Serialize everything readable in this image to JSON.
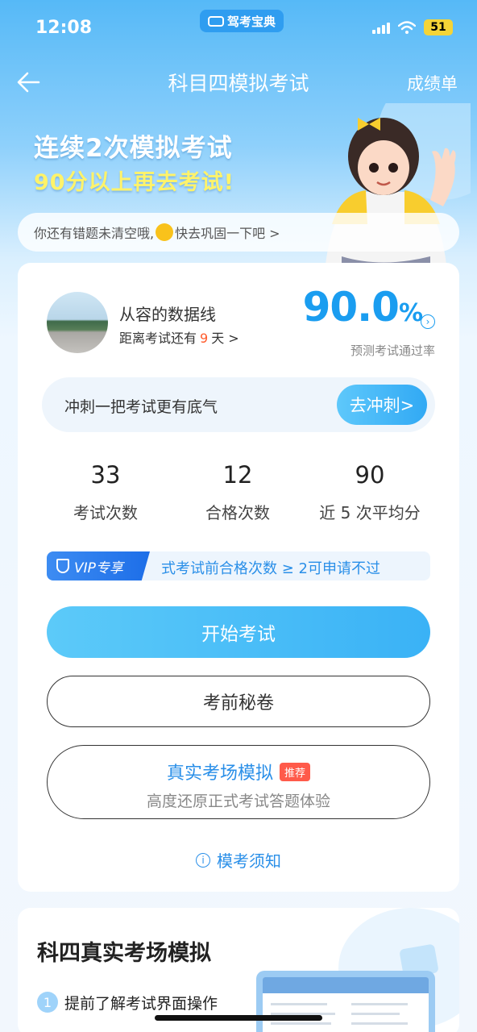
{
  "status_bar": {
    "time": "12:08",
    "app_name": "驾考宝典",
    "battery": "51"
  },
  "nav": {
    "title": "科目四模拟考试",
    "right_link": "成绩单",
    "back_icon": "arrow-left-icon"
  },
  "banner": {
    "line1": "连续2次模拟考试",
    "line2": "90分以上再去考试!"
  },
  "tip": {
    "text_before": "你还有错题未清空哦,",
    "text_after": "快去巩固一下吧 >"
  },
  "profile": {
    "name": "从容的数据线",
    "countdown_prefix": "距离考试还有",
    "countdown_days": "9",
    "countdown_suffix": "天  >"
  },
  "pass_rate": {
    "value": "90.0",
    "unit": "%",
    "label": "预测考试通过率"
  },
  "sprint": {
    "text": "冲刺一把考试更有底气",
    "button": "去冲刺>"
  },
  "stats": [
    {
      "value": "33",
      "label": "考试次数"
    },
    {
      "value": "12",
      "label": "合格次数"
    },
    {
      "value": "90",
      "label": "近 5 次平均分"
    }
  ],
  "vip": {
    "badge": "VIP专享",
    "text": "式考试前合格次数 ≥ 2可申请不过"
  },
  "buttons": {
    "start": "开始考试",
    "secret": "考前秘卷",
    "real_title": "真实考场模拟",
    "real_tag": "推荐",
    "real_subtitle": "高度还原正式考试答题体验"
  },
  "notice": "模考须知",
  "section": {
    "title": "科四真实考场模拟",
    "step1_num": "1",
    "step1_text": "提前了解考试界面操作"
  },
  "colors": {
    "accent": "#1a9df0",
    "primary_button": "#3ab2f6",
    "highlight": "#ff5a2a",
    "banner_yellow": "#fff36a"
  }
}
